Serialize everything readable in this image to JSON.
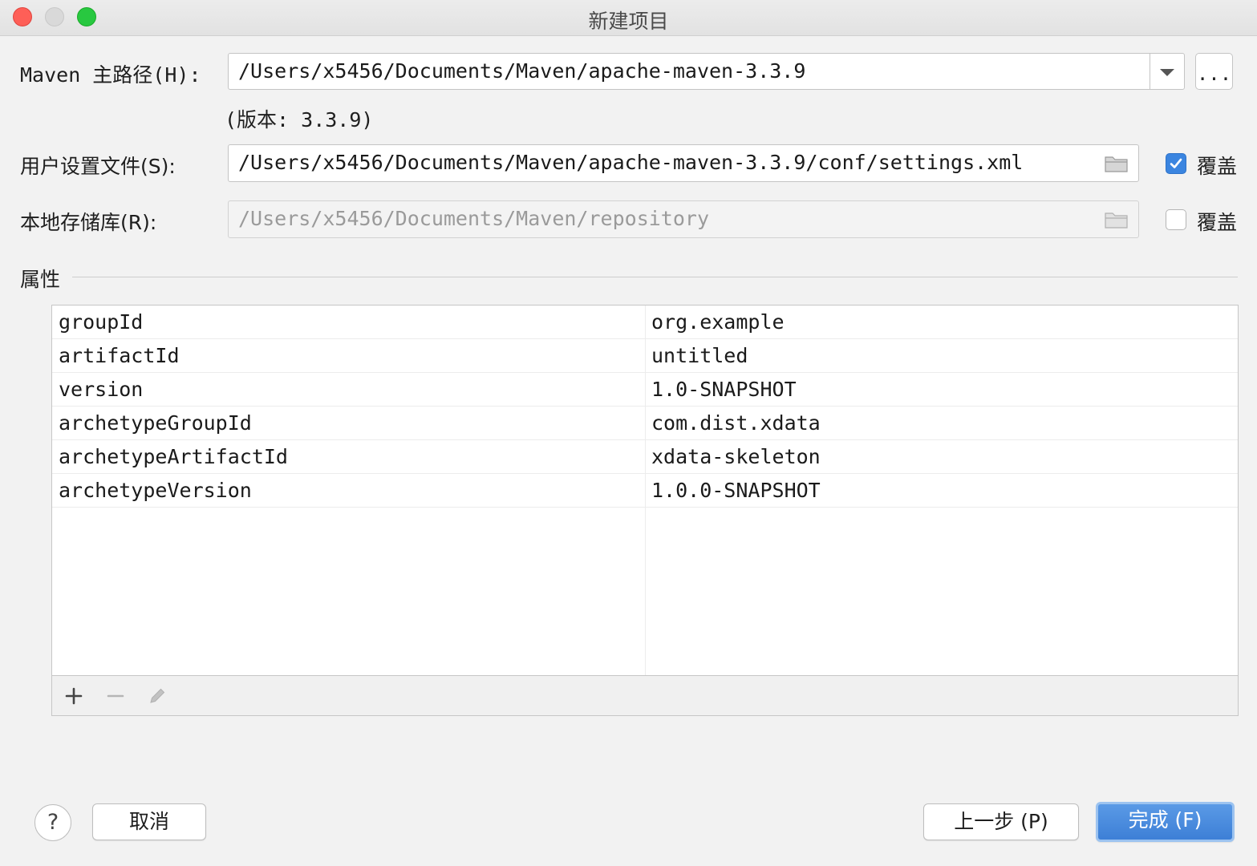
{
  "window": {
    "title": "新建项目",
    "traffic_lights": {
      "close": "#fe5f57",
      "minimize": "#d9d9d9",
      "zoom": "#28c840"
    }
  },
  "form": {
    "maven_home": {
      "label": "Maven 主路径(H):",
      "value": "/Users/x5456/Documents/Maven/apache-maven-3.3.9",
      "version_note": "(版本: 3.3.9)",
      "browse_label": "..."
    },
    "user_settings": {
      "label": "用户设置文件(S):",
      "value": "/Users/x5456/Documents/Maven/apache-maven-3.3.9/conf/settings.xml",
      "override_label": "覆盖",
      "override_checked": true
    },
    "local_repo": {
      "label": "本地存储库(R):",
      "value": "/Users/x5456/Documents/Maven/repository",
      "override_label": "覆盖",
      "override_checked": false
    }
  },
  "properties": {
    "section_title": "属性",
    "rows": [
      {
        "key": "groupId",
        "value": "org.example"
      },
      {
        "key": "artifactId",
        "value": "untitled"
      },
      {
        "key": "version",
        "value": "1.0-SNAPSHOT"
      },
      {
        "key": "archetypeGroupId",
        "value": "com.dist.xdata"
      },
      {
        "key": "archetypeArtifactId",
        "value": "xdata-skeleton"
      },
      {
        "key": "archetypeVersion",
        "value": "1.0.0-SNAPSHOT"
      }
    ],
    "toolbar": [
      "plus-icon",
      "minus-icon",
      "pencil-icon"
    ]
  },
  "footer": {
    "help_label": "?",
    "cancel_label": "取消",
    "previous_label": "上一步 (P)",
    "finish_label": "完成 (F)",
    "accent": "#3d7fd6"
  }
}
